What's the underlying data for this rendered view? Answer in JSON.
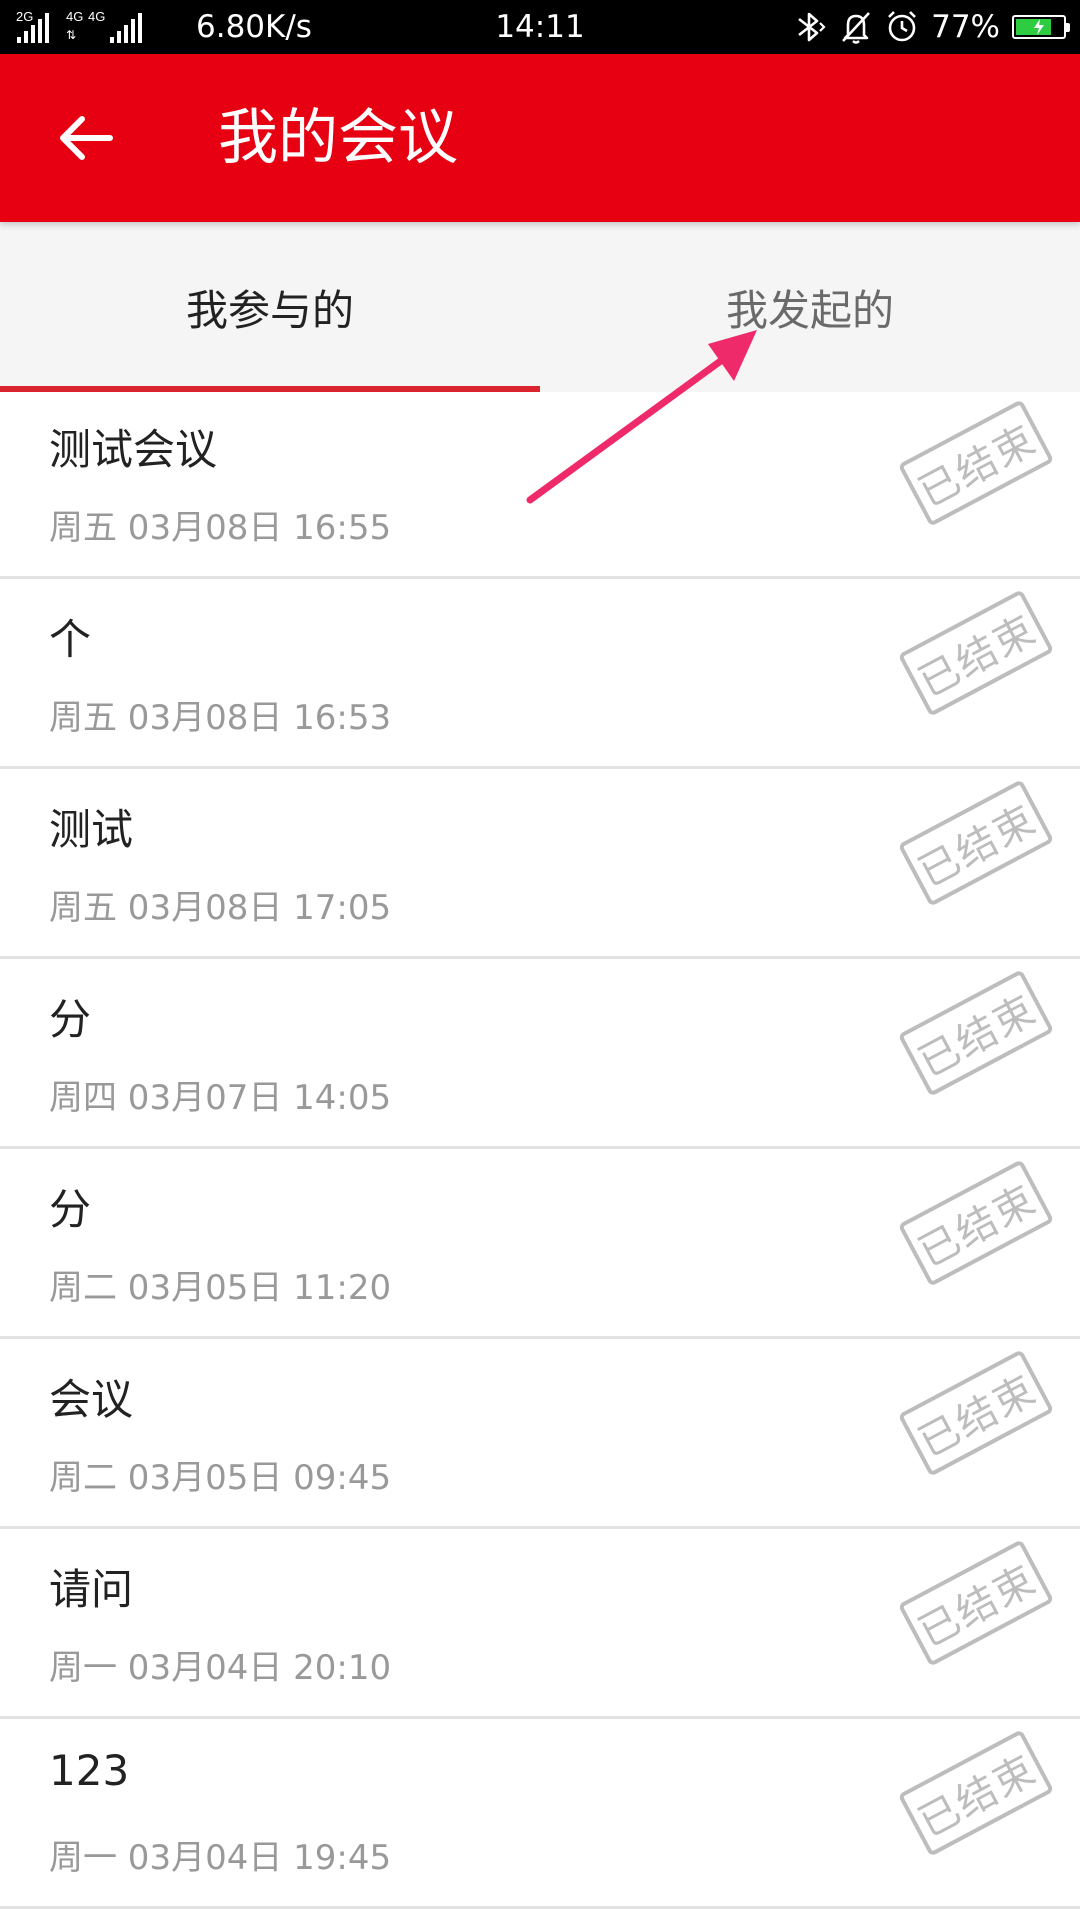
{
  "status_bar": {
    "network_labels": [
      "2G",
      "4G",
      "4G"
    ],
    "net_speed": "6.80K/s",
    "time": "14:11",
    "battery_percent": "77%",
    "battery_level": 0.77,
    "icons": [
      "signal-icon",
      "bluetooth-icon",
      "mute-bell-icon",
      "alarm-icon",
      "battery-charging-icon"
    ]
  },
  "header": {
    "title": "我的会议",
    "back_icon": "arrow-left-icon"
  },
  "tabs": [
    {
      "label": "我参与的",
      "active": true
    },
    {
      "label": "我发起的",
      "active": false
    }
  ],
  "meetings": [
    {
      "title": "测试会议",
      "time": "周五 03月08日 16:55",
      "status": "已结束"
    },
    {
      "title": "个",
      "time": "周五 03月08日 16:53",
      "status": "已结束"
    },
    {
      "title": "测试",
      "time": "周五 03月08日 17:05",
      "status": "已结束"
    },
    {
      "title": "分",
      "time": "周四 03月07日 14:05",
      "status": "已结束"
    },
    {
      "title": "分",
      "time": "周二 03月05日 11:20",
      "status": "已结束"
    },
    {
      "title": "会议",
      "time": "周二 03月05日 09:45",
      "status": "已结束"
    },
    {
      "title": "请问",
      "time": "周一 03月04日 20:10",
      "status": "已结束"
    },
    {
      "title": "123",
      "time": "周一 03月04日 19:45",
      "status": "已结束"
    }
  ],
  "colors": {
    "primary": "#e60012",
    "tab_indicator": "#d9232d",
    "annotation_arrow": "#ee2a6a",
    "stamp": "#bdbdbd",
    "battery": "#2ecc40"
  }
}
